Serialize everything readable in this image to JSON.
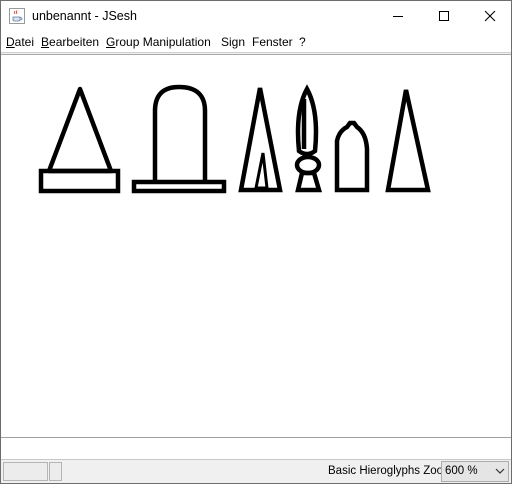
{
  "window": {
    "title": "unbenannt - JSesh",
    "icon": "java-coffee-cup-icon",
    "controls": [
      "minimize-icon",
      "maximize-icon",
      "close-icon"
    ]
  },
  "menu": {
    "items": [
      {
        "mnemonic": "D",
        "rest": "atei"
      },
      {
        "mnemonic": "B",
        "rest": "earbeiten"
      },
      {
        "mnemonic": "G",
        "rest": "roup Manipulation"
      },
      {
        "mnemonic": "",
        "rest": "Sign"
      },
      {
        "mnemonic": "",
        "rest": "Fenster"
      },
      {
        "mnemonic": "",
        "rest": "?"
      }
    ]
  },
  "canvas": {
    "glyphs": [
      "triangle-on-base-glyph",
      "rounded-stela-on-base-glyph",
      "split-obelisk-glyph",
      "feather-plume-glyph",
      "loaf-cone-glyph",
      "thin-cone-glyph"
    ]
  },
  "status": {
    "palette_label": "Basic Hieroglyphs",
    "zoom_label": "Zoom",
    "zoom_value": "600 %"
  },
  "colors": {
    "ink": "#000000",
    "background": "#ffffff",
    "statusbar": "#f0f0f0"
  }
}
